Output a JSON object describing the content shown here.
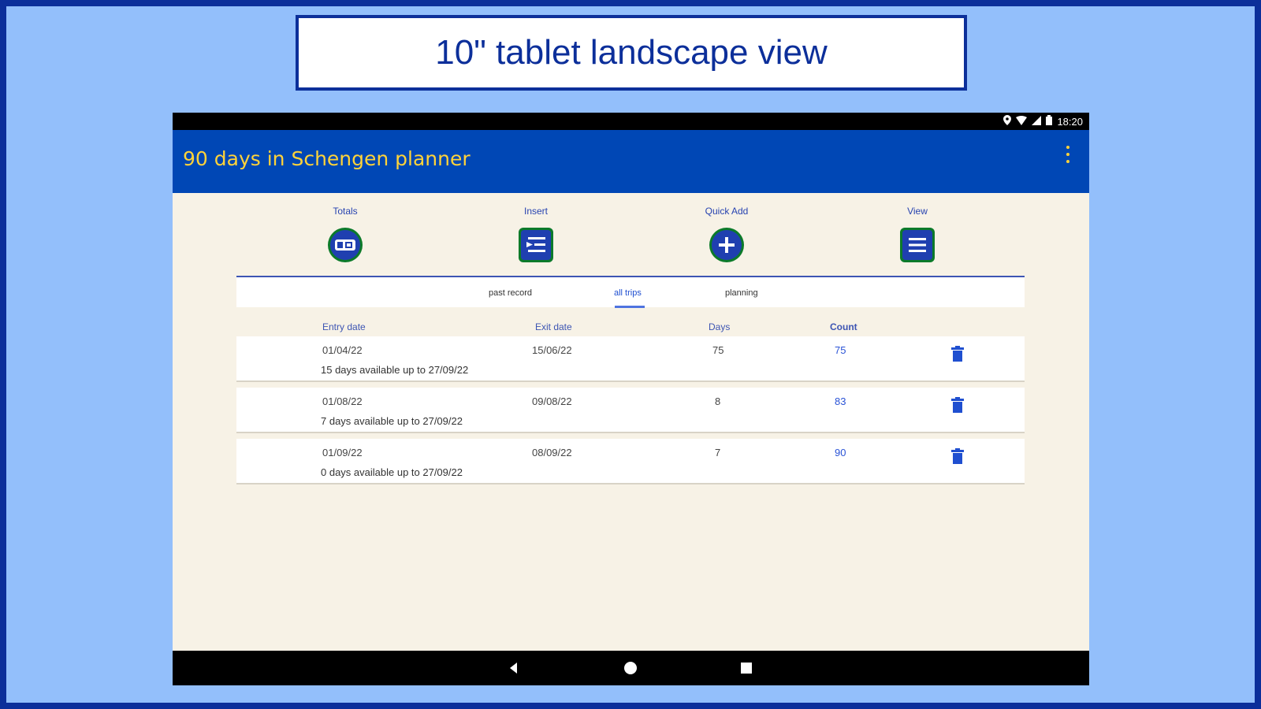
{
  "caption": "10\" tablet landscape view",
  "status_bar": {
    "time": "18:20",
    "icons": [
      "location-icon",
      "wifi-icon",
      "signal-icon",
      "battery-icon"
    ]
  },
  "app_bar": {
    "title": "90 days in Schengen planner",
    "menu_icon": "overflow-menu-icon"
  },
  "actions": [
    {
      "label": "Totals",
      "icon": "totals-icon"
    },
    {
      "label": "Insert",
      "icon": "insert-icon"
    },
    {
      "label": "Quick Add",
      "icon": "plus-icon"
    },
    {
      "label": "View",
      "icon": "list-icon"
    }
  ],
  "tabs": [
    {
      "label": "past record",
      "active": false
    },
    {
      "label": "all trips",
      "active": true
    },
    {
      "label": "planning",
      "active": false
    }
  ],
  "table": {
    "headers": [
      "Entry date",
      "Exit date",
      "Days",
      "Count"
    ],
    "rows": [
      {
        "entry": "01/04/22",
        "exit": "15/06/22",
        "days": "75",
        "count": "75",
        "availability": "15 days available up to 27/09/22"
      },
      {
        "entry": "01/08/22",
        "exit": "09/08/22",
        "days": "8",
        "count": "83",
        "availability": "7 days available up to 27/09/22"
      },
      {
        "entry": "01/09/22",
        "exit": "08/09/22",
        "days": "7",
        "count": "90",
        "availability": "0 days available up to 27/09/22"
      }
    ]
  },
  "colors": {
    "background": "#93bffb",
    "app_bar": "#0047b5",
    "title": "#ffd339",
    "accent": "#1f4fd0",
    "icon_ring": "#0c7a2a",
    "delete": "#1f4fd0"
  }
}
